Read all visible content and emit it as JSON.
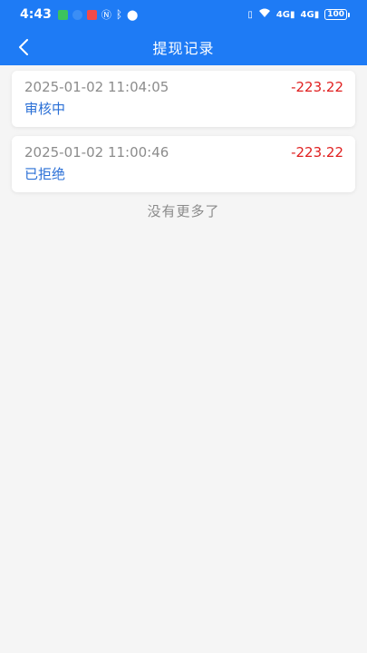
{
  "status_bar": {
    "time": "4:43",
    "network_1": "4G",
    "network_2": "4G",
    "battery": "100"
  },
  "header": {
    "title": "提现记录",
    "back_icon": "chevron-left-icon"
  },
  "records": [
    {
      "time": "2025-01-02 11:04:05",
      "amount": "-223.22",
      "status": "审核中"
    },
    {
      "time": "2025-01-02 11:00:46",
      "amount": "-223.22",
      "status": "已拒绝"
    }
  ],
  "footer": {
    "no_more_text": "没有更多了"
  },
  "colors": {
    "primary": "#1e7bf5",
    "amount": "#e02020",
    "status": "#2a6fd6",
    "muted": "#8c8c8c",
    "background": "#f5f5f5"
  }
}
